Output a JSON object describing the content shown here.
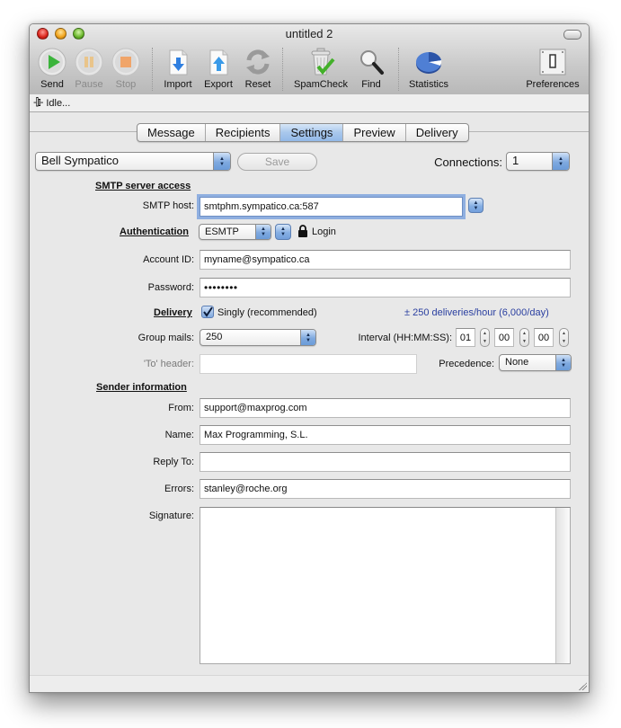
{
  "window": {
    "title": "untitled 2"
  },
  "toolbar": {
    "items": [
      {
        "id": "send",
        "label": "Send",
        "icon": "play-icon",
        "enabled": true
      },
      {
        "id": "pause",
        "label": "Pause",
        "icon": "pause-icon",
        "enabled": false
      },
      {
        "id": "stop",
        "label": "Stop",
        "icon": "stop-icon",
        "enabled": false
      },
      {
        "id": "import",
        "label": "Import",
        "icon": "import-document-icon",
        "enabled": true
      },
      {
        "id": "export",
        "label": "Export",
        "icon": "export-document-icon",
        "enabled": true
      },
      {
        "id": "reset",
        "label": "Reset",
        "icon": "reset-arrows-icon",
        "enabled": true
      },
      {
        "id": "spamcheck",
        "label": "SpamCheck",
        "icon": "trash-check-icon",
        "enabled": true
      },
      {
        "id": "find",
        "label": "Find",
        "icon": "magnifier-icon",
        "enabled": true
      },
      {
        "id": "statistics",
        "label": "Statistics",
        "icon": "pie-chart-icon",
        "enabled": true
      },
      {
        "id": "preferences",
        "label": "Preferences",
        "icon": "switch-icon",
        "enabled": true
      }
    ]
  },
  "status": {
    "icon": "plug-icon",
    "text": "Idle..."
  },
  "tabs": [
    {
      "label": "Message",
      "active": false
    },
    {
      "label": "Recipients",
      "active": false
    },
    {
      "label": "Settings",
      "active": true
    },
    {
      "label": "Preview",
      "active": false
    },
    {
      "label": "Delivery",
      "active": false
    }
  ],
  "settings": {
    "profile": "Bell Sympatico",
    "save_label": "Save",
    "connections_label": "Connections:",
    "connections_value": "1",
    "smtp_section": "SMTP server access",
    "smtp_host_label": "SMTP host:",
    "smtp_host_value": "smtphm.sympatico.ca:587",
    "auth_section": "Authentication",
    "auth_value": "ESMTP",
    "login_label": "Login",
    "account_label": "Account ID:",
    "account_value": "myname@sympatico.ca",
    "password_label": "Password:",
    "password_value": "••••••••",
    "delivery_section": "Delivery",
    "singly_label": "Singly (recommended)",
    "singly_checked": true,
    "rate_text": "± 250 deliveries/hour (6,000/day)",
    "group_label": "Group mails:",
    "group_value": "250",
    "interval_label": "Interval (HH:MM:SS):",
    "interval_hh": "01",
    "interval_mm": "00",
    "interval_ss": "00",
    "to_header_label": "'To' header:",
    "to_header_value": "",
    "precedence_label": "Precedence:",
    "precedence_value": "None",
    "sender_section": "Sender information",
    "from_label": "From:",
    "from_value": "support@maxprog.com",
    "name_label": "Name:",
    "name_value": "Max Programming, S.L.",
    "reply_label": "Reply To:",
    "reply_value": "",
    "errors_label": "Errors:",
    "errors_value": "stanley@roche.org",
    "signature_label": "Signature:",
    "signature_value": ""
  },
  "colors": {
    "accent_blue": "#7fa9df",
    "rate_text": "#2a3fa0"
  }
}
